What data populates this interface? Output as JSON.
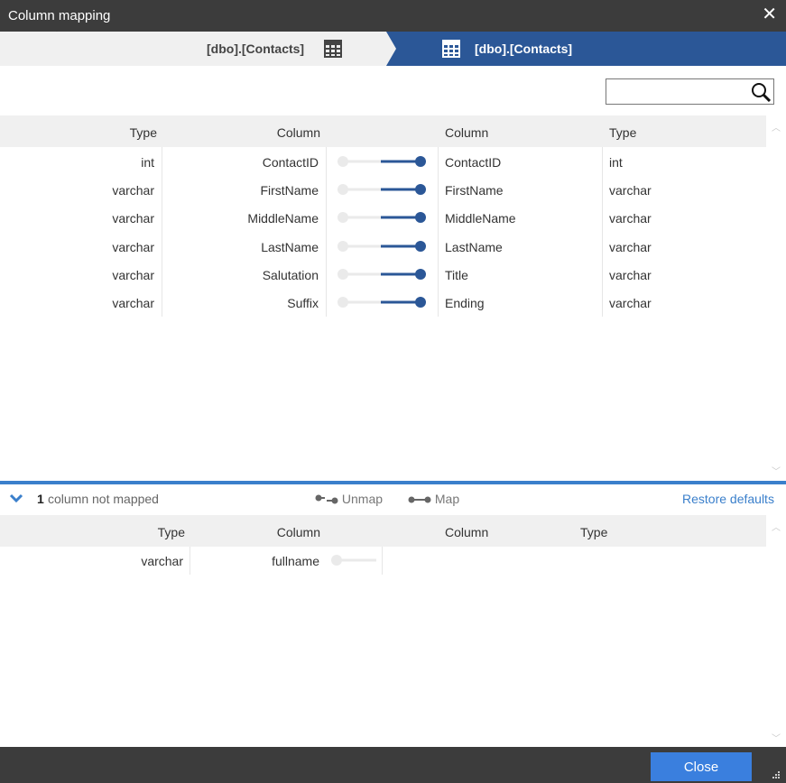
{
  "window": {
    "title": "Column mapping",
    "close_glyph": "✕"
  },
  "header": {
    "source_table": "[dbo].[Contacts]",
    "target_table": "[dbo].[Contacts]",
    "source_icon": "table-icon",
    "target_icon": "table-icon",
    "accent": "#2b5797"
  },
  "search": {
    "value": "",
    "placeholder": "",
    "icon": "search-icon"
  },
  "mapped": {
    "columns": {
      "src_type": "Type",
      "src_column": "Column",
      "tgt_column": "Column",
      "tgt_type": "Type"
    },
    "rows": [
      {
        "src_type": "int",
        "src_column": "ContactID",
        "tgt_column": "ContactID",
        "tgt_type": "int"
      },
      {
        "src_type": "varchar",
        "src_column": "FirstName",
        "tgt_column": "FirstName",
        "tgt_type": "varchar"
      },
      {
        "src_type": "varchar",
        "src_column": "MiddleName",
        "tgt_column": "MiddleName",
        "tgt_type": "varchar"
      },
      {
        "src_type": "varchar",
        "src_column": "LastName",
        "tgt_column": "LastName",
        "tgt_type": "varchar"
      },
      {
        "src_type": "varchar",
        "src_column": "Salutation",
        "tgt_column": "Title",
        "tgt_type": "varchar"
      },
      {
        "src_type": "varchar",
        "src_column": "Suffix",
        "tgt_column": "Ending",
        "tgt_type": "varchar"
      }
    ]
  },
  "unmapped_bar": {
    "count": "1",
    "label": "column not mapped",
    "unmap": "Unmap",
    "map": "Map",
    "restore": "Restore defaults",
    "accent": "#3a7fcb"
  },
  "unmapped": {
    "columns": {
      "src_type": "Type",
      "src_column": "Column",
      "tgt_column": "Column",
      "tgt_type": "Type"
    },
    "rows": [
      {
        "src_type": "varchar",
        "src_column": "fullname"
      }
    ]
  },
  "footer": {
    "close_label": "Close"
  }
}
